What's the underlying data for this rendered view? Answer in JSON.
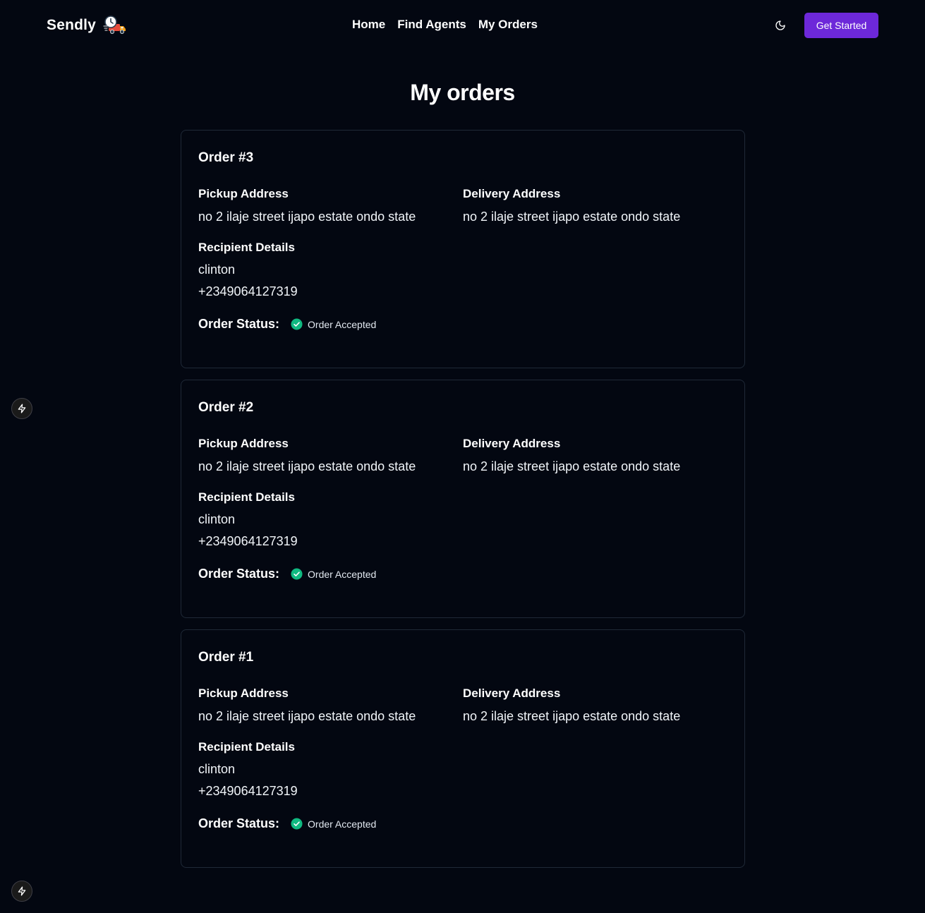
{
  "app": {
    "brand": "Sendly",
    "logo_icon": "delivery-truck-clock-icon"
  },
  "nav": {
    "links": [
      "Home",
      "Find Agents",
      "My Orders"
    ],
    "theme_icon": "moon-icon",
    "cta_label": "Get Started"
  },
  "page": {
    "title": "My orders"
  },
  "labels": {
    "pickup": "Pickup Address",
    "delivery": "Delivery Address",
    "recipient": "Recipient Details",
    "status": "Order Status:"
  },
  "orders": [
    {
      "title": "Order #3",
      "pickup": "no 2 ilaje street ijapo estate ondo state",
      "delivery": "no 2 ilaje street ijapo estate ondo state",
      "recipient_name": "clinton",
      "recipient_phone": "+2349064127319",
      "status": "Order Accepted"
    },
    {
      "title": "Order #2",
      "pickup": "no 2 ilaje street ijapo estate ondo state",
      "delivery": "no 2 ilaje street ijapo estate ondo state",
      "recipient_name": "clinton",
      "recipient_phone": "+2349064127319",
      "status": "Order Accepted"
    },
    {
      "title": "Order #1",
      "pickup": "no 2 ilaje street ijapo estate ondo state",
      "delivery": "no 2 ilaje street ijapo estate ondo state",
      "recipient_name": "clinton",
      "recipient_phone": "+2349064127319",
      "status": "Order Accepted"
    }
  ],
  "colors": {
    "background": "#030711",
    "accent": "#6d28d9",
    "status_success": "#10b981",
    "card_border": "#1f2937"
  },
  "floating_icons": [
    "lightning-icon",
    "lightning-icon"
  ]
}
